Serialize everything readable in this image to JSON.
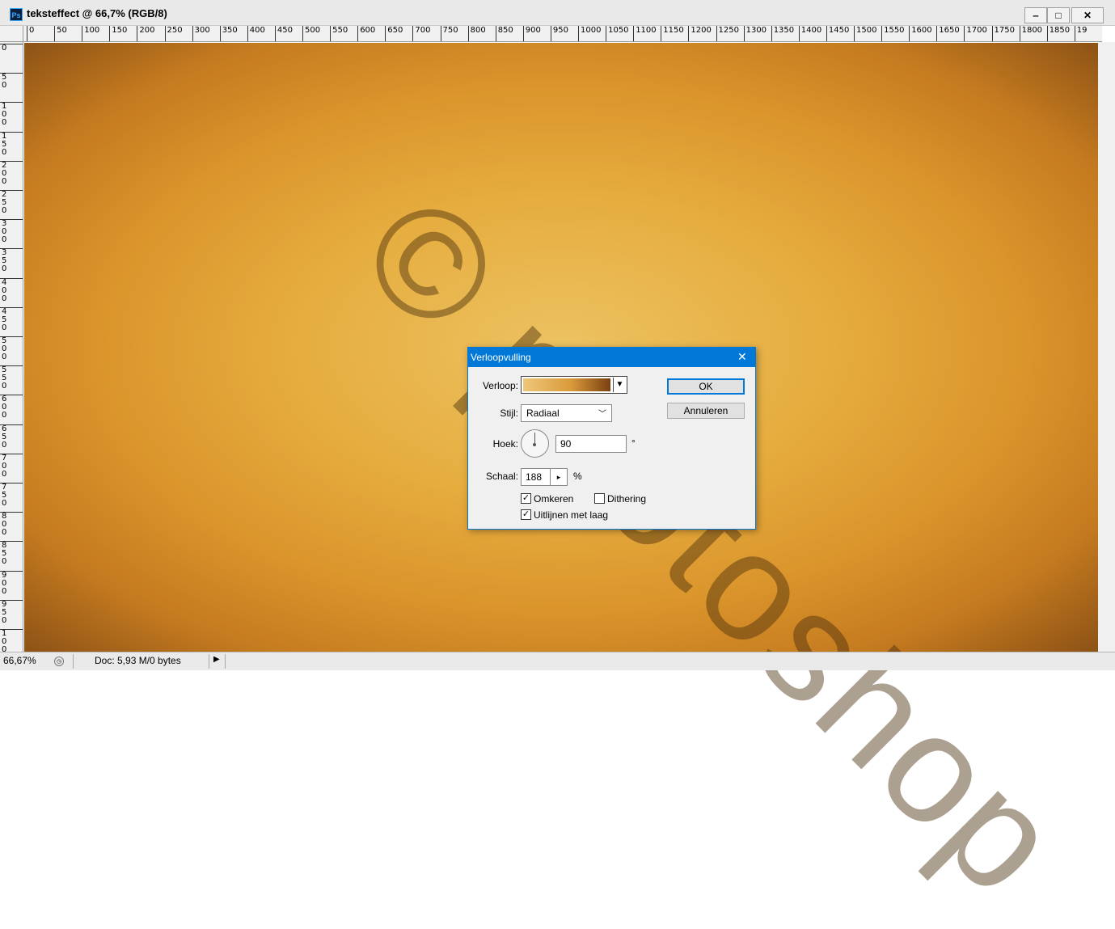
{
  "window": {
    "app_icon": "Ps",
    "title": "teksteffect @ 66,7% (RGB/8)",
    "minimize": "‒",
    "maximize": "□",
    "close": "✕"
  },
  "ruler_h": [
    "0",
    "50",
    "100",
    "150",
    "200",
    "250",
    "300",
    "350",
    "400",
    "450",
    "500",
    "550",
    "600",
    "650",
    "700",
    "750",
    "800",
    "850",
    "900",
    "950",
    "1000",
    "1050",
    "1100",
    "1150",
    "1200",
    "1250",
    "1300",
    "1350",
    "1400",
    "1450",
    "1500",
    "1550",
    "1600",
    "1650",
    "1700",
    "1750",
    "1800",
    "1850",
    "19"
  ],
  "ruler_v": [
    "0",
    "50",
    "100",
    "150",
    "200",
    "250",
    "300",
    "350",
    "400",
    "450",
    "500",
    "550",
    "600",
    "650",
    "700",
    "750",
    "800",
    "850",
    "900",
    "950",
    "100"
  ],
  "watermark": "© photoshop",
  "status": {
    "zoom": "66,67%",
    "doc": "Doc: 5,93 M/0 bytes",
    "arrow": "▶"
  },
  "dialog": {
    "title": "Verloopvulling",
    "close": "✕",
    "gradient_label": "Verloop:",
    "style_label": "Stijl:",
    "style_value": "Radiaal",
    "angle_label": "Hoek:",
    "angle_value": "90",
    "angle_unit": "°",
    "scale_label": "Schaal:",
    "scale_value": "188",
    "scale_unit": "%",
    "reverse_label": "Omkeren",
    "reverse_checked": true,
    "dither_label": "Dithering",
    "dither_checked": false,
    "align_label": "Uitlijnen met laag",
    "align_checked": true,
    "ok": "OK",
    "cancel": "Annuleren"
  },
  "colors": {
    "canvas_center": "#ecc261",
    "canvas_edge": "#8f5416",
    "accent": "#0078d7"
  }
}
